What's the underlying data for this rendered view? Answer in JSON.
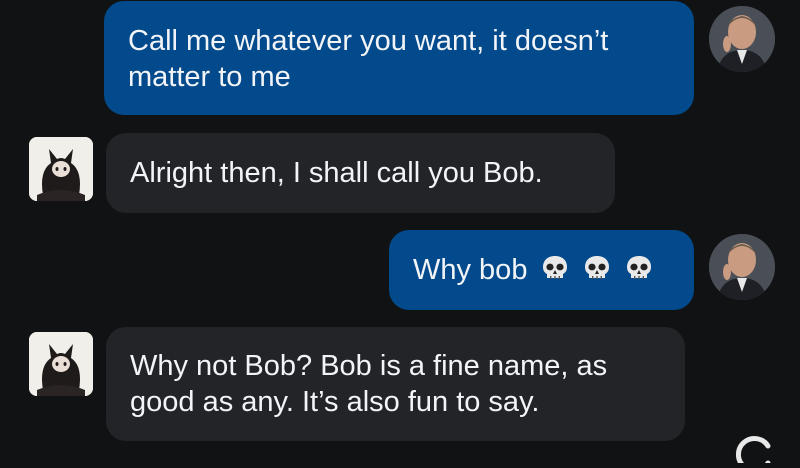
{
  "conversation": {
    "messages": [
      {
        "role": "user",
        "text": "Call me whatever you want, it doesn’t matter to me"
      },
      {
        "role": "bot",
        "text": "Alright then, I shall call you Bob."
      },
      {
        "role": "user",
        "text": "Why bob",
        "emoji": [
          "skull-emoji",
          "skull-emoji",
          "skull-emoji"
        ]
      },
      {
        "role": "bot",
        "text": "Why not Bob? Bob is a fine name, as good as any. It’s also fun to say."
      }
    ]
  },
  "colors": {
    "background": "#111213",
    "user_bubble": "#024a8b",
    "bot_bubble": "#222427",
    "text": "#f2f4f7"
  },
  "icons": {
    "user_avatar": "man-portrait-avatar",
    "bot_avatar": "black-cat-character-avatar",
    "emoji": "skull-emoji",
    "corner": "g-logo-icon"
  }
}
